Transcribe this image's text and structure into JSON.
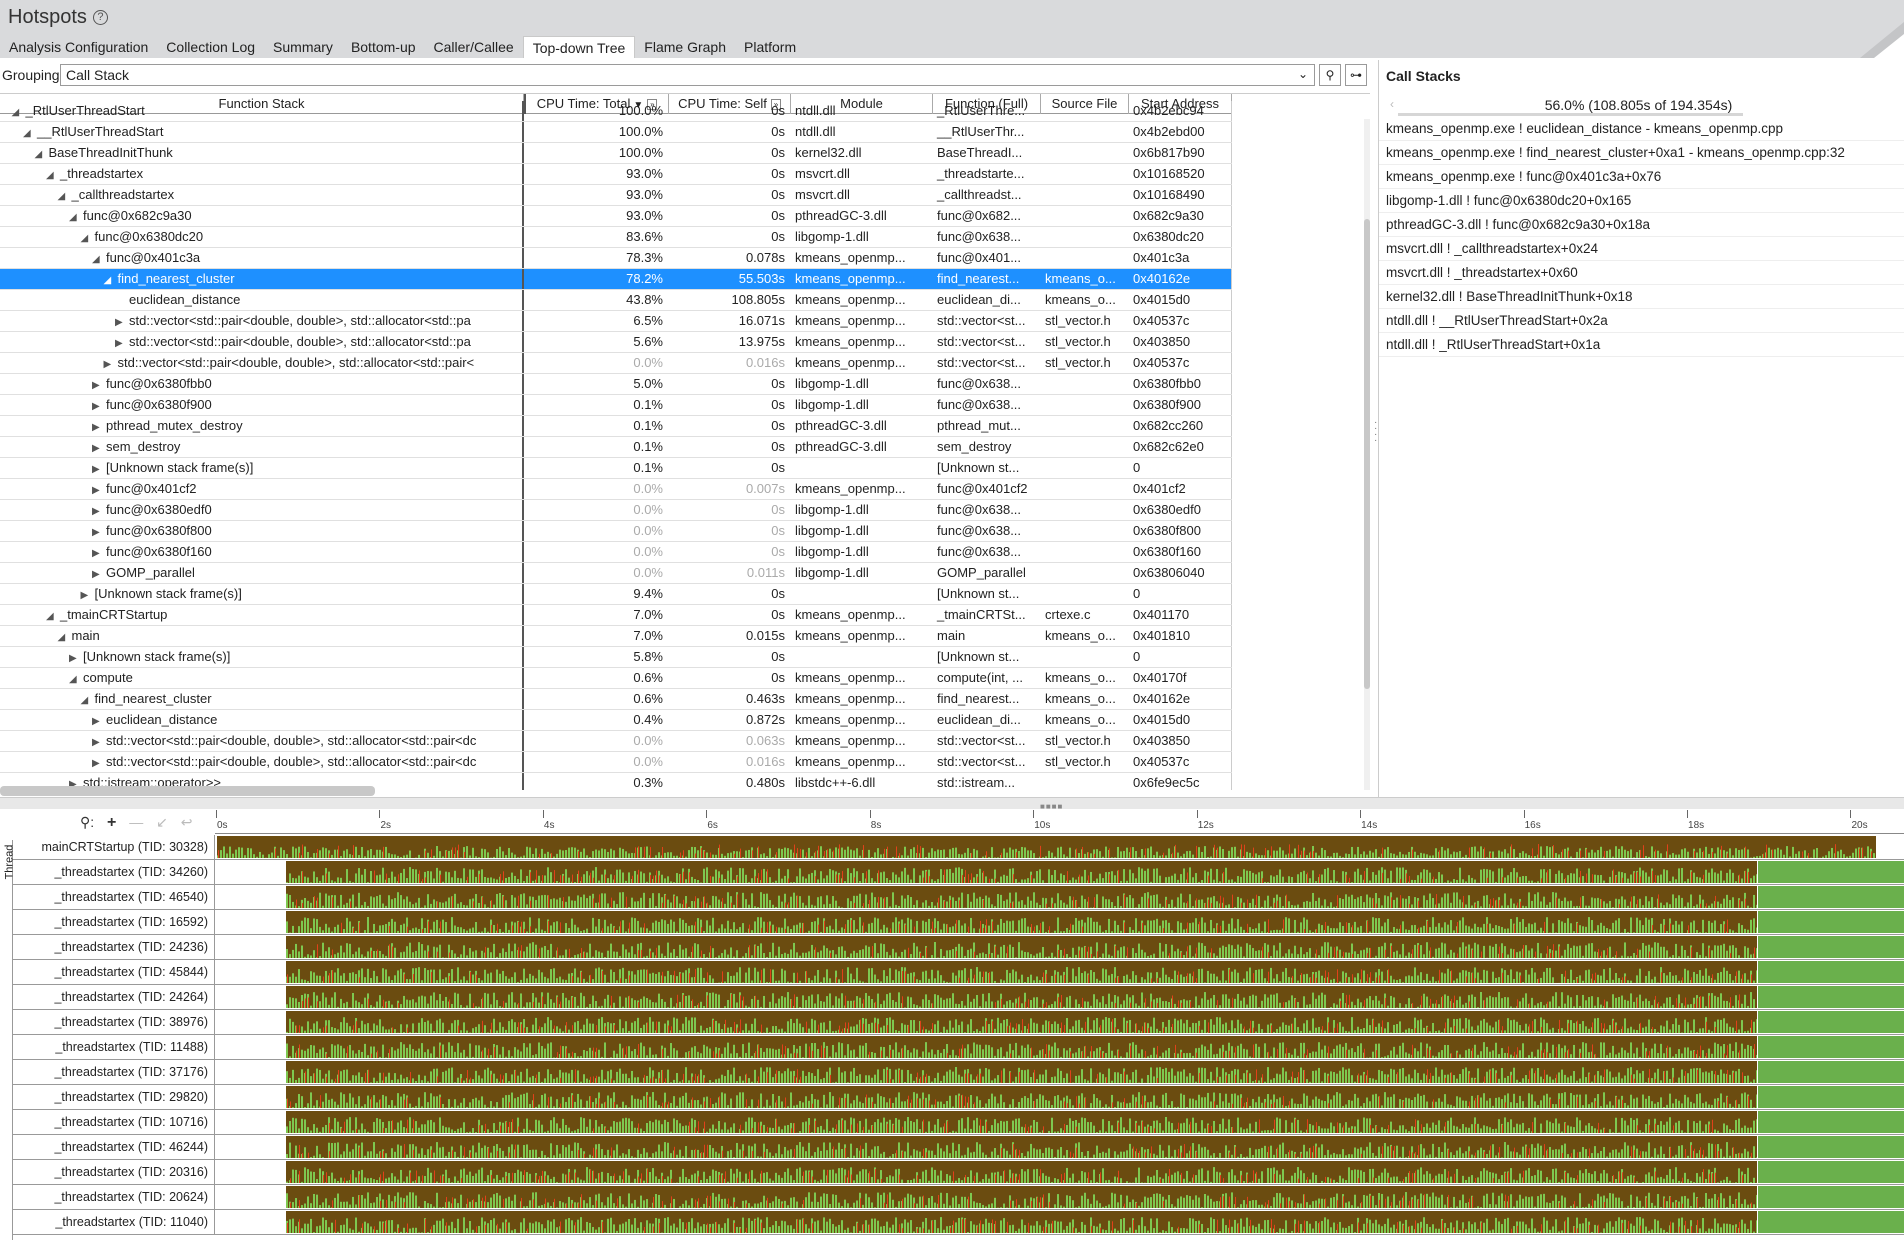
{
  "header": {
    "title": "Hotspots",
    "help_glyph": "?",
    "tabs": [
      "Analysis Configuration",
      "Collection Log",
      "Summary",
      "Bottom-up",
      "Caller/Callee",
      "Top-down Tree",
      "Flame Graph",
      "Platform"
    ],
    "active_tab": "Top-down Tree"
  },
  "grouping": {
    "label": "Grouping:",
    "value": "Call Stack"
  },
  "grid": {
    "columns": [
      "Function Stack",
      "CPU Time: Total",
      "CPU Time: Self",
      "Module",
      "Function (Full)",
      "Source File",
      "Start Address"
    ],
    "rows": [
      {
        "depth": 1,
        "exp": "open",
        "fn": "_RtlUserThreadStart",
        "total": "100.0%",
        "self": "0s",
        "mod": "ntdll.dll",
        "full": "_RtlUserThre...",
        "src": "",
        "addr": "0x4b2ebc94",
        "dim": false
      },
      {
        "depth": 2,
        "exp": "open",
        "fn": "__RtlUserThreadStart",
        "total": "100.0%",
        "self": "0s",
        "mod": "ntdll.dll",
        "full": "__RtlUserThr...",
        "src": "",
        "addr": "0x4b2ebd00",
        "dim": false
      },
      {
        "depth": 3,
        "exp": "open",
        "fn": "BaseThreadInitThunk",
        "total": "100.0%",
        "self": "0s",
        "mod": "kernel32.dll",
        "full": "BaseThreadI...",
        "src": "",
        "addr": "0x6b817b90",
        "dim": false
      },
      {
        "depth": 4,
        "exp": "open",
        "fn": "_threadstartex",
        "total": "93.0%",
        "self": "0s",
        "mod": "msvcrt.dll",
        "full": "_threadstarte...",
        "src": "",
        "addr": "0x10168520",
        "dim": false
      },
      {
        "depth": 5,
        "exp": "open",
        "fn": "_callthreadstartex",
        "total": "93.0%",
        "self": "0s",
        "mod": "msvcrt.dll",
        "full": "_callthreadst...",
        "src": "",
        "addr": "0x10168490",
        "dim": false
      },
      {
        "depth": 6,
        "exp": "open",
        "fn": "func@0x682c9a30",
        "total": "93.0%",
        "self": "0s",
        "mod": "pthreadGC-3.dll",
        "full": "func@0x682...",
        "src": "",
        "addr": "0x682c9a30",
        "dim": false
      },
      {
        "depth": 7,
        "exp": "open",
        "fn": "func@0x6380dc20",
        "total": "83.6%",
        "self": "0s",
        "mod": "libgomp-1.dll",
        "full": "func@0x638...",
        "src": "",
        "addr": "0x6380dc20",
        "dim": false
      },
      {
        "depth": 8,
        "exp": "open",
        "fn": "func@0x401c3a",
        "total": "78.3%",
        "self": "0.078s",
        "mod": "kmeans_openmp...",
        "full": "func@0x401...",
        "src": "",
        "addr": "0x401c3a",
        "dim": false
      },
      {
        "depth": 9,
        "exp": "open",
        "fn": "find_nearest_cluster",
        "total": "78.2%",
        "self": "55.503s",
        "mod": "kmeans_openmp...",
        "full": "find_nearest...",
        "src": "kmeans_o...",
        "addr": "0x40162e",
        "dim": false,
        "sel": true
      },
      {
        "depth": 10,
        "exp": "none",
        "fn": "euclidean_distance",
        "total": "43.8%",
        "self": "108.805s",
        "mod": "kmeans_openmp...",
        "full": "euclidean_di...",
        "src": "kmeans_o...",
        "addr": "0x4015d0",
        "dim": false
      },
      {
        "depth": 10,
        "exp": "closed",
        "fn": "std::vector<std::pair<double, double>, std::allocator<std::pa",
        "total": "6.5%",
        "self": "16.071s",
        "mod": "kmeans_openmp...",
        "full": "std::vector<st...",
        "src": "stl_vector.h",
        "addr": "0x40537c",
        "dim": false
      },
      {
        "depth": 10,
        "exp": "closed",
        "fn": "std::vector<std::pair<double, double>, std::allocator<std::pa",
        "total": "5.6%",
        "self": "13.975s",
        "mod": "kmeans_openmp...",
        "full": "std::vector<st...",
        "src": "stl_vector.h",
        "addr": "0x403850",
        "dim": false
      },
      {
        "depth": 9,
        "exp": "closed",
        "fn": "std::vector<std::pair<double, double>, std::allocator<std::pair<",
        "total": "0.0%",
        "self": "0.016s",
        "mod": "kmeans_openmp...",
        "full": "std::vector<st...",
        "src": "stl_vector.h",
        "addr": "0x40537c",
        "dim": true
      },
      {
        "depth": 8,
        "exp": "closed",
        "fn": "func@0x6380fbb0",
        "total": "5.0%",
        "self": "0s",
        "mod": "libgomp-1.dll",
        "full": "func@0x638...",
        "src": "",
        "addr": "0x6380fbb0",
        "dim": false
      },
      {
        "depth": 8,
        "exp": "closed",
        "fn": "func@0x6380f900",
        "total": "0.1%",
        "self": "0s",
        "mod": "libgomp-1.dll",
        "full": "func@0x638...",
        "src": "",
        "addr": "0x6380f900",
        "dim": false
      },
      {
        "depth": 8,
        "exp": "closed",
        "fn": "pthread_mutex_destroy",
        "total": "0.1%",
        "self": "0s",
        "mod": "pthreadGC-3.dll",
        "full": "pthread_mut...",
        "src": "",
        "addr": "0x682cc260",
        "dim": false
      },
      {
        "depth": 8,
        "exp": "closed",
        "fn": "sem_destroy",
        "total": "0.1%",
        "self": "0s",
        "mod": "pthreadGC-3.dll",
        "full": "sem_destroy",
        "src": "",
        "addr": "0x682c62e0",
        "dim": false
      },
      {
        "depth": 8,
        "exp": "closed",
        "fn": "[Unknown stack frame(s)]",
        "total": "0.1%",
        "self": "0s",
        "mod": "",
        "full": "[Unknown st...",
        "src": "",
        "addr": "0",
        "dim": false
      },
      {
        "depth": 8,
        "exp": "closed",
        "fn": "func@0x401cf2",
        "total": "0.0%",
        "self": "0.007s",
        "mod": "kmeans_openmp...",
        "full": "func@0x401cf2",
        "src": "",
        "addr": "0x401cf2",
        "dim": true
      },
      {
        "depth": 8,
        "exp": "closed",
        "fn": "func@0x6380edf0",
        "total": "0.0%",
        "self": "0s",
        "mod": "libgomp-1.dll",
        "full": "func@0x638...",
        "src": "",
        "addr": "0x6380edf0",
        "dim": true
      },
      {
        "depth": 8,
        "exp": "closed",
        "fn": "func@0x6380f800",
        "total": "0.0%",
        "self": "0s",
        "mod": "libgomp-1.dll",
        "full": "func@0x638...",
        "src": "",
        "addr": "0x6380f800",
        "dim": true
      },
      {
        "depth": 8,
        "exp": "closed",
        "fn": "func@0x6380f160",
        "total": "0.0%",
        "self": "0s",
        "mod": "libgomp-1.dll",
        "full": "func@0x638...",
        "src": "",
        "addr": "0x6380f160",
        "dim": true
      },
      {
        "depth": 8,
        "exp": "closed",
        "fn": "GOMP_parallel",
        "total": "0.0%",
        "self": "0.011s",
        "mod": "libgomp-1.dll",
        "full": "GOMP_parallel",
        "src": "",
        "addr": "0x63806040",
        "dim": true
      },
      {
        "depth": 7,
        "exp": "closed",
        "fn": "[Unknown stack frame(s)]",
        "total": "9.4%",
        "self": "0s",
        "mod": "",
        "full": "[Unknown st...",
        "src": "",
        "addr": "0",
        "dim": false
      },
      {
        "depth": 4,
        "exp": "open",
        "fn": "_tmainCRTStartup",
        "total": "7.0%",
        "self": "0s",
        "mod": "kmeans_openmp...",
        "full": "_tmainCRTSt...",
        "src": "crtexe.c",
        "addr": "0x401170",
        "dim": false
      },
      {
        "depth": 5,
        "exp": "open",
        "fn": "main",
        "total": "7.0%",
        "self": "0.015s",
        "mod": "kmeans_openmp...",
        "full": "main",
        "src": "kmeans_o...",
        "addr": "0x401810",
        "dim": false
      },
      {
        "depth": 6,
        "exp": "closed",
        "fn": "[Unknown stack frame(s)]",
        "total": "5.8%",
        "self": "0s",
        "mod": "",
        "full": "[Unknown st...",
        "src": "",
        "addr": "0",
        "dim": false
      },
      {
        "depth": 6,
        "exp": "open",
        "fn": "compute",
        "total": "0.6%",
        "self": "0s",
        "mod": "kmeans_openmp...",
        "full": "compute(int, ...",
        "src": "kmeans_o...",
        "addr": "0x40170f",
        "dim": false
      },
      {
        "depth": 7,
        "exp": "open",
        "fn": "find_nearest_cluster",
        "total": "0.6%",
        "self": "0.463s",
        "mod": "kmeans_openmp...",
        "full": "find_nearest...",
        "src": "kmeans_o...",
        "addr": "0x40162e",
        "dim": false
      },
      {
        "depth": 8,
        "exp": "closed",
        "fn": "euclidean_distance",
        "total": "0.4%",
        "self": "0.872s",
        "mod": "kmeans_openmp...",
        "full": "euclidean_di...",
        "src": "kmeans_o...",
        "addr": "0x4015d0",
        "dim": false
      },
      {
        "depth": 8,
        "exp": "closed",
        "fn": "std::vector<std::pair<double, double>, std::allocator<std::pair<dc",
        "total": "0.0%",
        "self": "0.063s",
        "mod": "kmeans_openmp...",
        "full": "std::vector<st...",
        "src": "stl_vector.h",
        "addr": "0x403850",
        "dim": true
      },
      {
        "depth": 8,
        "exp": "closed",
        "fn": "std::vector<std::pair<double, double>, std::allocator<std::pair<dc",
        "total": "0.0%",
        "self": "0.016s",
        "mod": "kmeans_openmp...",
        "full": "std::vector<st...",
        "src": "stl_vector.h",
        "addr": "0x40537c",
        "dim": true
      },
      {
        "depth": 6,
        "exp": "closed",
        "fn": "std::istream::operator>>",
        "total": "0.3%",
        "self": "0.480s",
        "mod": "libstdc++-6.dll",
        "full": "std::istream...",
        "src": "",
        "addr": "0x6fe9ec5c",
        "dim": false
      }
    ]
  },
  "call_stacks": {
    "title": "Call Stacks",
    "summary": "56.0% (108.805s of 194.354s)",
    "items": [
      "kmeans_openmp.exe ! euclidean_distance - kmeans_openmp.cpp",
      "kmeans_openmp.exe ! find_nearest_cluster+0xa1 - kmeans_openmp.cpp:32",
      "kmeans_openmp.exe ! func@0x401c3a+0x76",
      "libgomp-1.dll ! func@0x6380dc20+0x165",
      "pthreadGC-3.dll ! func@0x682c9a30+0x18a",
      "msvcrt.dll ! _callthreadstartex+0x24",
      "msvcrt.dll ! _threadstartex+0x60",
      "kernel32.dll ! BaseThreadInitThunk+0x18",
      "ntdll.dll ! __RtlUserThreadStart+0x2a",
      "ntdll.dll ! _RtlUserThreadStart+0x1a"
    ]
  },
  "timeline": {
    "side_label": "Thread",
    "ticks": [
      "0s",
      "2s",
      "4s",
      "6s",
      "8s",
      "10s",
      "12s",
      "14s",
      "16s",
      "18s",
      "20s"
    ],
    "max_seconds": 20.3,
    "colors": {
      "busy": "#6b4c10",
      "idle": "#6ab04c",
      "spike": "#e0411a",
      "green": "#7ec850"
    },
    "threads": [
      {
        "name": "mainCRTStartup (TID: 30328)",
        "start_s": 0.0,
        "end_s": 20.3,
        "tail_green": false
      },
      {
        "name": "_threadstartex (TID: 34260)",
        "start_s": 0.85,
        "end_s": 18.85,
        "tail_green": true
      },
      {
        "name": "_threadstartex (TID: 46540)",
        "start_s": 0.85,
        "end_s": 18.85,
        "tail_green": true
      },
      {
        "name": "_threadstartex (TID: 16592)",
        "start_s": 0.85,
        "end_s": 18.85,
        "tail_green": true
      },
      {
        "name": "_threadstartex (TID: 24236)",
        "start_s": 0.85,
        "end_s": 18.85,
        "tail_green": true
      },
      {
        "name": "_threadstartex (TID: 45844)",
        "start_s": 0.85,
        "end_s": 18.85,
        "tail_green": true
      },
      {
        "name": "_threadstartex (TID: 24264)",
        "start_s": 0.85,
        "end_s": 18.85,
        "tail_green": true
      },
      {
        "name": "_threadstartex (TID: 38976)",
        "start_s": 0.85,
        "end_s": 18.85,
        "tail_green": true
      },
      {
        "name": "_threadstartex (TID: 11488)",
        "start_s": 0.85,
        "end_s": 18.85,
        "tail_green": true
      },
      {
        "name": "_threadstartex (TID: 37176)",
        "start_s": 0.85,
        "end_s": 18.85,
        "tail_green": true
      },
      {
        "name": "_threadstartex (TID: 29820)",
        "start_s": 0.85,
        "end_s": 18.85,
        "tail_green": true
      },
      {
        "name": "_threadstartex (TID: 10716)",
        "start_s": 0.85,
        "end_s": 18.85,
        "tail_green": true
      },
      {
        "name": "_threadstartex (TID: 46244)",
        "start_s": 0.85,
        "end_s": 18.85,
        "tail_green": true
      },
      {
        "name": "_threadstartex (TID: 20316)",
        "start_s": 0.85,
        "end_s": 18.85,
        "tail_green": true
      },
      {
        "name": "_threadstartex (TID: 20624)",
        "start_s": 0.85,
        "end_s": 18.85,
        "tail_green": true
      },
      {
        "name": "_threadstartex (TID: 11040)",
        "start_s": 0.85,
        "end_s": 18.85,
        "tail_green": true
      }
    ]
  }
}
